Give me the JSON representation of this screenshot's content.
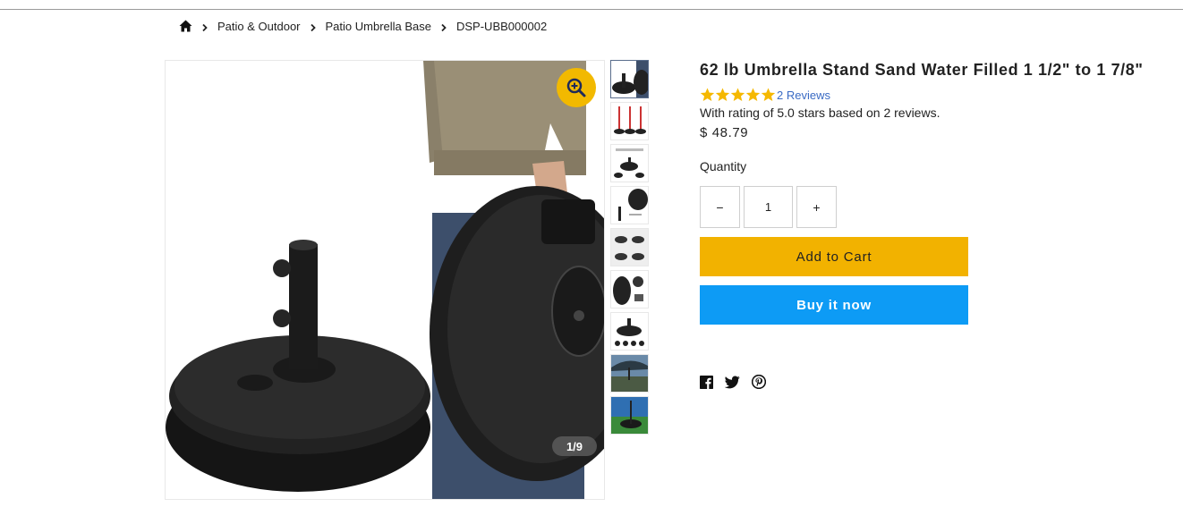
{
  "breadcrumb": {
    "home_icon": "home-icon",
    "items": [
      "Patio & Outdoor",
      "Patio Umbrella Base",
      "DSP-UBB000002"
    ]
  },
  "gallery": {
    "counter": "1/9",
    "zoom_icon": "zoom-in-icon",
    "thumbnail_count": 9,
    "accent_color": "#f2b900"
  },
  "product": {
    "title": "62 lb Umbrella Stand Sand Water Filled 1 1/2\" to 1 7/8\"",
    "stars": 5,
    "reviews_link": "2 Reviews",
    "rating_text": "With rating of 5.0 stars based on 2 reviews.",
    "price": "$ 48.79"
  },
  "quantity": {
    "label": "Quantity",
    "value": "1",
    "minus": "−",
    "plus": "+"
  },
  "buttons": {
    "add_to_cart": "Add to Cart",
    "buy_now": "Buy it now",
    "add_to_cart_color": "#f2b200",
    "buy_now_color": "#0d9bf5"
  },
  "share": {
    "icons": [
      "facebook-icon",
      "twitter-icon",
      "pinterest-icon"
    ]
  }
}
